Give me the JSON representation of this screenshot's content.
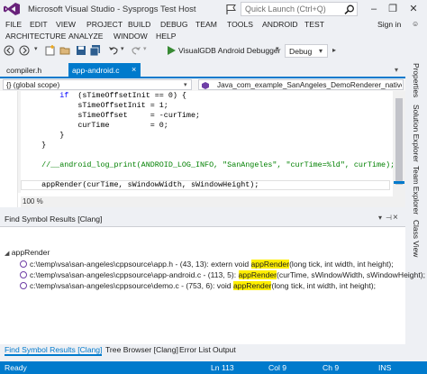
{
  "window": {
    "title": "Microsoft Visual Studio - Sysprogs Test Host",
    "quick_launch_placeholder": "Quick Launch (Ctrl+Q)",
    "user": "Sign in"
  },
  "menu": {
    "row1": [
      "FILE",
      "EDIT",
      "VIEW",
      "PROJECT",
      "BUILD",
      "DEBUG",
      "TEAM",
      "TOOLS",
      "ANDROID",
      "TEST"
    ],
    "row2": [
      "ARCHITECTURE",
      "ANALYZE",
      "WINDOW",
      "HELP"
    ]
  },
  "toolbar": {
    "start_label": "VisualGDB Android Debugger",
    "configuration": "Debug"
  },
  "doc_tabs": {
    "inactive": "compiler.h",
    "active": "app-android.c"
  },
  "nav_bar": {
    "scope": "{} (global scope)",
    "function": "Java_com_example_SanAngeles_DemoRenderer_nativeR"
  },
  "editor": {
    "lines": [
      {
        "indent": "        ",
        "parts": [
          [
            "kw",
            "if"
          ],
          [
            "",
            "  (sTimeOffsetInit == 0) {"
          ]
        ]
      },
      {
        "indent": "            ",
        "parts": [
          [
            "",
            "sTimeOffsetInit = 1;"
          ]
        ]
      },
      {
        "indent": "            ",
        "parts": [
          [
            "",
            "sTimeOffset     = -curTime;"
          ]
        ]
      },
      {
        "indent": "            ",
        "parts": [
          [
            "",
            "curTime         = 0;"
          ]
        ]
      },
      {
        "indent": "        ",
        "parts": [
          [
            "",
            "}"
          ]
        ]
      },
      {
        "indent": "    ",
        "parts": [
          [
            "",
            "}"
          ]
        ]
      },
      {
        "indent": "",
        "parts": [
          [
            "",
            ""
          ]
        ]
      },
      {
        "indent": "    ",
        "parts": [
          [
            "cmt",
            "//__android_log_print(ANDROID_LOG_INFO, \"SanAngeles\", \"curTime=%ld\", curTime);"
          ]
        ]
      },
      {
        "indent": "",
        "parts": [
          [
            "",
            ""
          ]
        ]
      },
      {
        "indent": "    ",
        "parts": [
          [
            "",
            "appRender(curTime, sWindowWidth, sWindowHeight);"
          ]
        ]
      }
    ],
    "zoom": "100 %"
  },
  "side_tabs": [
    "Properties",
    "Solution Explorer",
    "Team Explorer",
    "Class View"
  ],
  "find_panel": {
    "title": "Find Symbol Results [Clang]",
    "root": "appRender",
    "results": [
      {
        "prefix": "c:\\temp\\vsa\\san-angeles\\cppsource\\app.h - (43, 13): extern void ",
        "match": "appRender",
        "suffix": "(long tick, int width, int height);"
      },
      {
        "prefix": "c:\\temp\\vsa\\san-angeles\\cppsource\\app-android.c - (113, 5): ",
        "match": "appRender",
        "suffix": "(curTime, sWindowWidth, sWindowHeight);"
      },
      {
        "prefix": "c:\\temp\\vsa\\san-angeles\\cppsource\\demo.c - (753, 6): void ",
        "match": "appRender",
        "suffix": "(long tick, int width, int height);"
      }
    ]
  },
  "bottom_tabs": [
    "Find Symbol Results [Clang]",
    "Tree Browser [Clang]",
    "Error List",
    "Output"
  ],
  "status": {
    "state": "Ready",
    "line": "Ln 113",
    "col": "Col 9",
    "ch": "Ch 9",
    "mode": "INS"
  },
  "colors": {
    "accent": "#007acc",
    "highlight": "#ffef00",
    "comment": "#008000",
    "keyword": "#0000ff"
  }
}
